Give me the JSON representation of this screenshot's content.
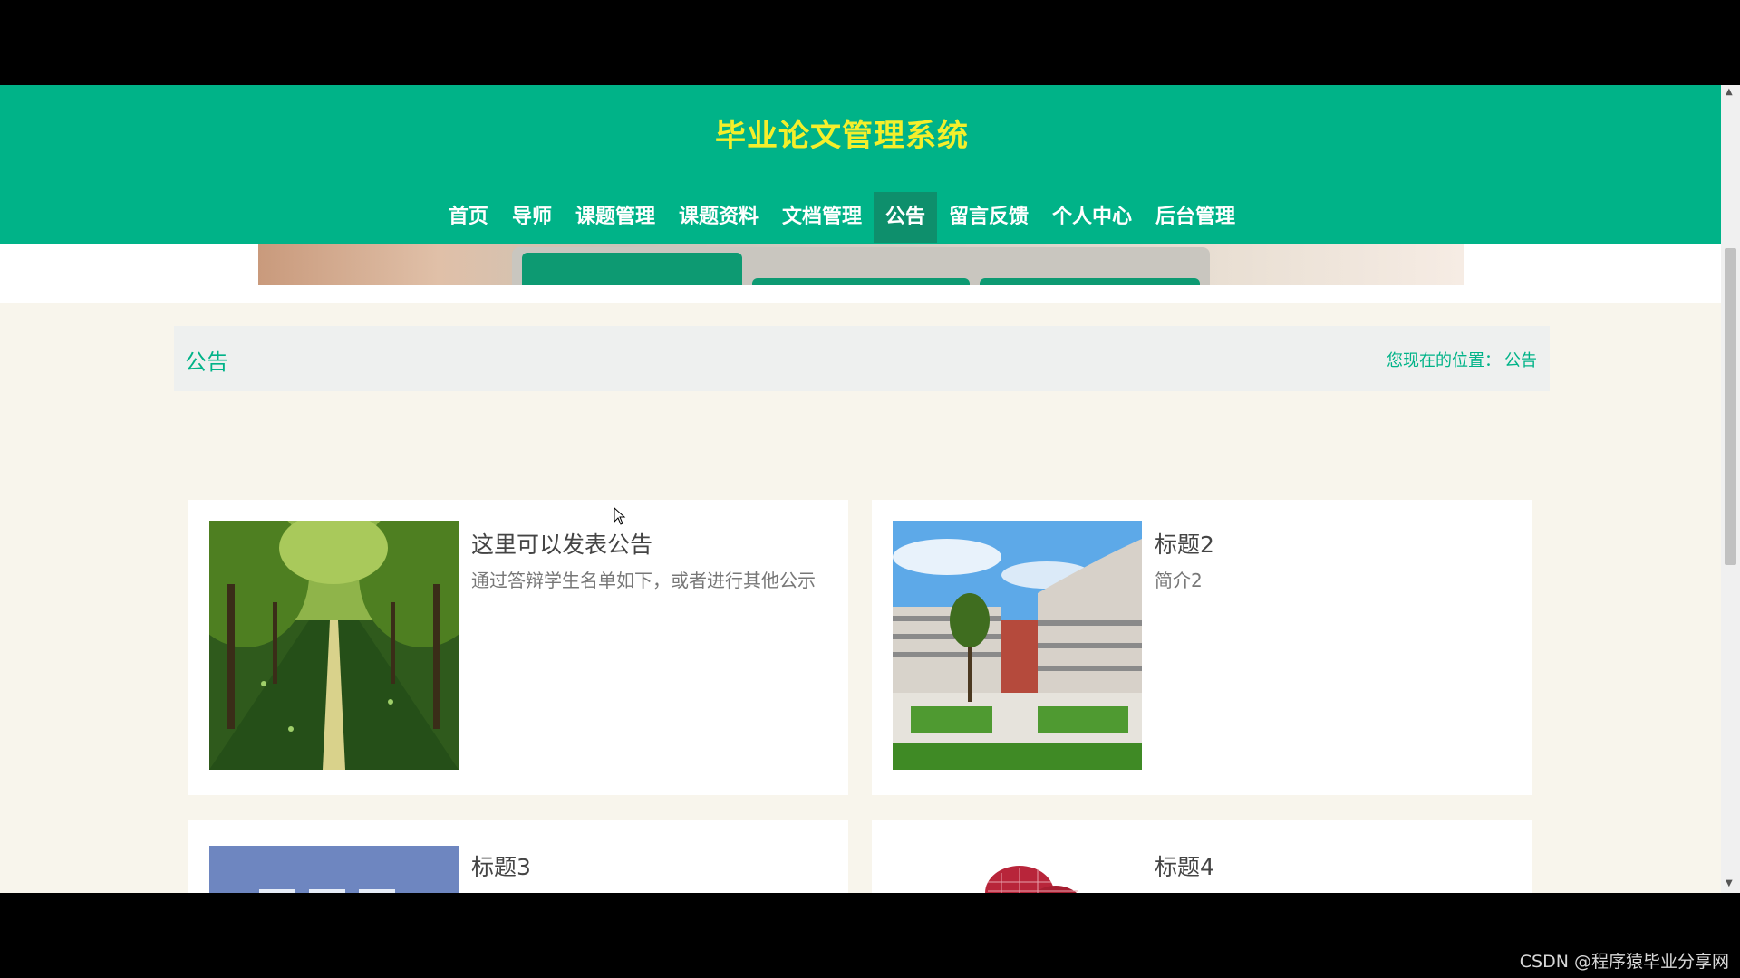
{
  "watermark": "CSDN @程序猿毕业分享网",
  "header": {
    "site_title": "毕业论文管理系统",
    "nav": [
      {
        "label": "首页",
        "active": false
      },
      {
        "label": "导师",
        "active": false
      },
      {
        "label": "课题管理",
        "active": false
      },
      {
        "label": "课题资料",
        "active": false
      },
      {
        "label": "文档管理",
        "active": false
      },
      {
        "label": "公告",
        "active": true
      },
      {
        "label": "留言反馈",
        "active": false
      },
      {
        "label": "个人中心",
        "active": false
      },
      {
        "label": "后台管理",
        "active": false
      }
    ]
  },
  "breadcrumb": {
    "title": "公告",
    "location_prefix": "您现在的位置：",
    "location_current": "公告"
  },
  "cards": [
    {
      "title": "这里可以发表公告",
      "desc": "通过答辩学生名单如下，或者进行其他公示",
      "image": "tree-lined-road-photo"
    },
    {
      "title": "标题2",
      "desc": "简介2",
      "image": "campus-building-photo"
    },
    {
      "title": "标题3",
      "desc": "",
      "image": "blue-banner-photo"
    },
    {
      "title": "标题4",
      "desc": "",
      "image": "red-pattern-photo"
    }
  ],
  "colors": {
    "primary": "#00b388",
    "title_yellow": "#f4ef2b",
    "nav_active": "#0e8f6c",
    "page_bg": "#f8f5ec"
  }
}
